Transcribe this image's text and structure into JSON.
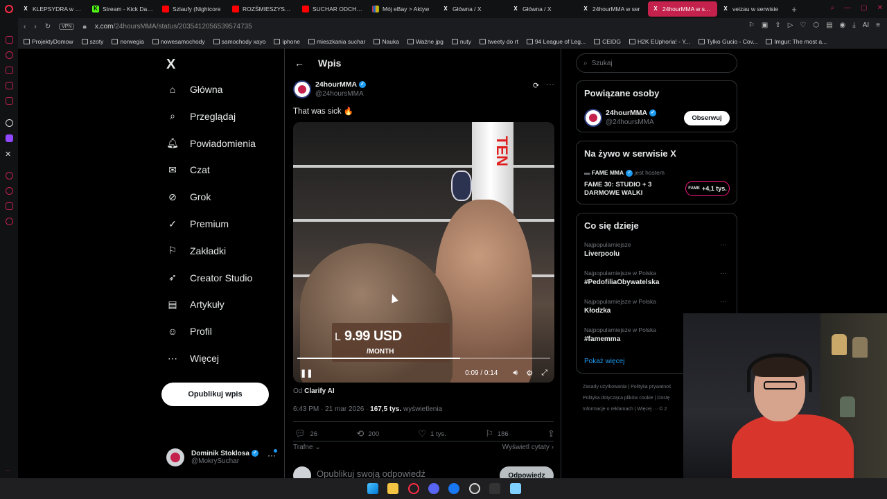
{
  "browser": {
    "tabs": [
      {
        "label": "KLEPSYDRA w ser",
        "icon": "x-icon"
      },
      {
        "label": "Stream - Kick Dash",
        "icon": "kick-icon"
      },
      {
        "label": "Szlaufy (Nightcore",
        "icon": "youtube-icon"
      },
      {
        "label": "ROZŚMIESZYSZ N",
        "icon": "youtube-icon"
      },
      {
        "label": "SUCHAR ODCHOD",
        "icon": "youtube-icon"
      },
      {
        "label": "Mój eBay > Aktyw",
        "icon": "ebay-icon"
      },
      {
        "label": "Główna / X",
        "icon": "x-icon"
      },
      {
        "label": "Główna / X",
        "icon": "x-icon"
      },
      {
        "label": "24hourMMA w ser",
        "icon": "x-icon"
      },
      {
        "label": "24hourMMA w serwis",
        "icon": "x-icon",
        "active": true
      },
      {
        "label": "veizau w serwisie",
        "icon": "x-icon"
      }
    ],
    "url_domain": "x.com",
    "url_path": "/24hoursMMA/status/2035412056539574735",
    "vpn_label": "VPN",
    "bookmarks": [
      "ProjektyDomow",
      "szoty",
      "norwegia",
      "nowesamochody",
      "samochody xayo",
      "iphone",
      "mieszkania suchar",
      "Nauka",
      "Ważne jpg",
      "nuty",
      "tweety do rt",
      "94 League of Leg...",
      "CEIDG",
      "H2K EUphoria! - Y...",
      "Tylko Gucio - Cov...",
      "Imgur: The most a..."
    ],
    "ai_label": "AI"
  },
  "nav": {
    "logo": "X",
    "items": [
      {
        "label": "Główna",
        "icon": "home-icon"
      },
      {
        "label": "Przeglądaj",
        "icon": "search-icon"
      },
      {
        "label": "Powiadomienia",
        "icon": "bell-icon"
      },
      {
        "label": "Czat",
        "icon": "mail-icon"
      },
      {
        "label": "Grok",
        "icon": "grok-icon"
      },
      {
        "label": "Premium",
        "icon": "premium-icon"
      },
      {
        "label": "Zakładki",
        "icon": "bookmark-icon"
      },
      {
        "label": "Creator Studio",
        "icon": "rocket-icon"
      },
      {
        "label": "Artykuły",
        "icon": "article-icon"
      },
      {
        "label": "Profil",
        "icon": "person-icon"
      },
      {
        "label": "Więcej",
        "icon": "more-circle-icon"
      }
    ],
    "post_button": "Opublikuj wpis",
    "account": {
      "name": "Dominik Stoklosa",
      "handle": "@MokrySuchar"
    }
  },
  "post": {
    "header_title": "Wpis",
    "author_name": "24hourMMA",
    "author_handle": "@24hoursMMA",
    "text": "That was sick 🔥",
    "video": {
      "ad_price": "9.99 USD",
      "ad_period": "/MONTH",
      "ad_prefix": "L",
      "time": "0:09 / 0:14",
      "progress": 0.643,
      "ring_brand": "TEN"
    },
    "attribution_prefix": "Od",
    "attribution_name": "Clarify AI",
    "timestamp": "6:43 PM · 21 mar 2026 ·",
    "views_count": "167,5 tys.",
    "views_label": "wyświetlenia",
    "actions": {
      "replies": "26",
      "reposts": "200",
      "likes": "1 tys.",
      "bookmarks": "186"
    },
    "sort_label": "Trafne",
    "quotes_label": "Wyświetl cytaty",
    "reply_placeholder": "Opublikuj swoją odpowiedź",
    "reply_button": "Odpowiedz"
  },
  "sidebar": {
    "search_placeholder": "Szukaj",
    "related": {
      "title": "Powiązane osoby",
      "name": "24hourMMA",
      "handle": "@24hoursMMA",
      "follow": "Obserwuj"
    },
    "live": {
      "title": "Na żywo w serwisie X",
      "host_name": "FAME MMA",
      "host_suffix": "jest hostem",
      "event": "FAME 30: STUDIO + 3 DARMOWE WALKI",
      "listeners": "+4,1 tys."
    },
    "trends": {
      "title": "Co się dzieje",
      "items": [
        {
          "category": "Najpopularniejsze",
          "name": "Liverpoolu"
        },
        {
          "category": "Najpopularniejsze w Polska",
          "name": "#PedofiliaObywatelska"
        },
        {
          "category": "Najpopularniejsze w Polska",
          "name": "Kłodzka"
        },
        {
          "category": "Najpopularniejsze w Polska",
          "name": "#famemma"
        }
      ],
      "show_more": "Pokaż więcej"
    },
    "footer": [
      "Zasady użytkowania",
      "Polityka prywatnoś",
      "Polityka dotycząca plików cookie",
      "Dostę",
      "Informacje o reklamach",
      "Więcej ···",
      "© 2"
    ]
  },
  "colors": {
    "accent": "#1d9bf0",
    "opera_red": "#c4224d",
    "live_pink": "#f91880"
  }
}
